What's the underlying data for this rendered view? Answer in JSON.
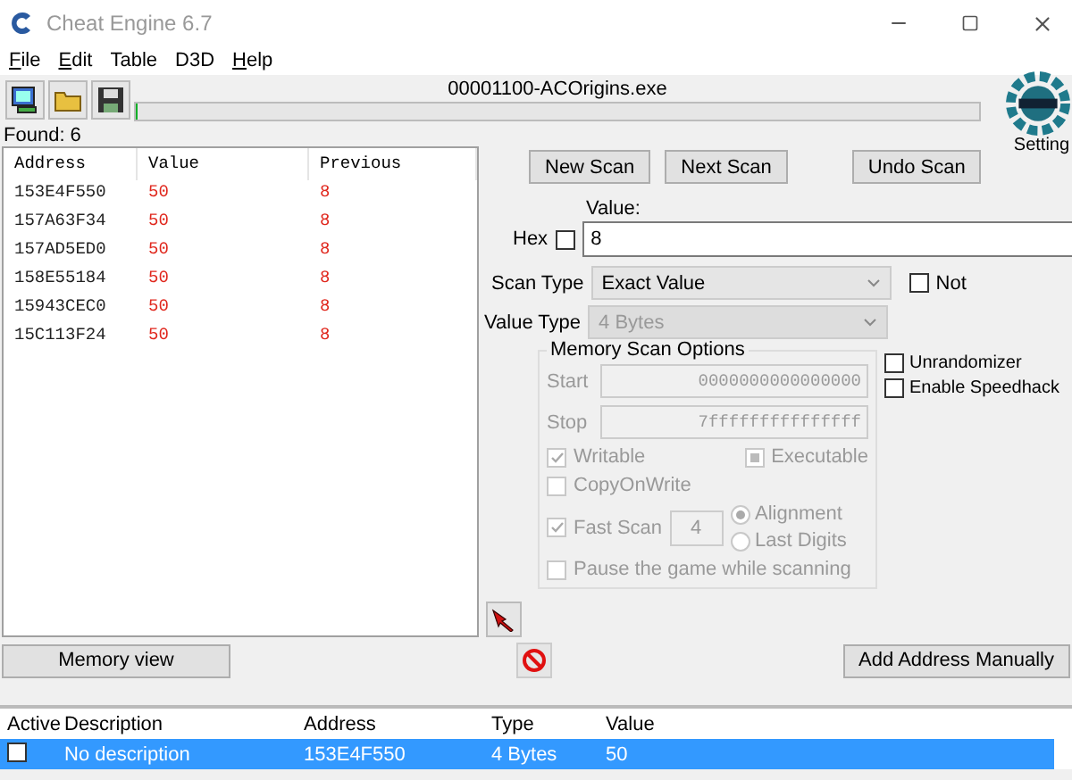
{
  "window": {
    "title": "Cheat Engine 6.7"
  },
  "menu": [
    {
      "label": "File",
      "underlined": true
    },
    {
      "label": "Edit",
      "underlined": true
    },
    {
      "label": "Table",
      "underlined": false
    },
    {
      "label": "D3D",
      "underlined": false
    },
    {
      "label": "Help",
      "underlined": true
    }
  ],
  "process": "00001100-ACOrigins.exe",
  "scan_progress": {
    "level": 0
  },
  "settings_label": "Setting",
  "found": "Found: 6",
  "results": {
    "columns": [
      "Address",
      "Value",
      "Previous"
    ],
    "rows": [
      [
        "153E4F550",
        "50",
        "8"
      ],
      [
        "157A63F34",
        "50",
        "8"
      ],
      [
        "157AD5ED0",
        "50",
        "8"
      ],
      [
        "158E55184",
        "50",
        "8"
      ],
      [
        "15943CEC0",
        "50",
        "8"
      ],
      [
        "15C113F24",
        "50",
        "8"
      ]
    ]
  },
  "scan_buttons": [
    "New Scan",
    "Next Scan",
    "Undo Scan"
  ],
  "value": {
    "label": "Value:",
    "hex_label": "Hex",
    "hex_checked": false,
    "text": "8"
  },
  "scan_type": {
    "label": "Scan Type",
    "value": "Exact Value",
    "disabled": false
  },
  "not_option": {
    "label": "Not",
    "checked": false
  },
  "value_type": {
    "label": "Value Type",
    "value": "4 Bytes",
    "disabled": true
  },
  "memory_options": {
    "title": "Memory Scan Options",
    "disabled": true,
    "start_label": "Start",
    "start": "0000000000000000",
    "stop_label": "Stop",
    "stop": "7fffffffffffffff",
    "writable": {
      "label": "Writable",
      "checked": true
    },
    "executable": {
      "label": "Executable",
      "partial": true
    },
    "copy_on_write": {
      "label": "CopyOnWrite",
      "checked": false
    },
    "fast_scan": {
      "label": "Fast Scan",
      "checked": true,
      "digits": "4"
    },
    "radios": [
      {
        "label": "Alignment",
        "selected": true
      },
      {
        "label": "Last Digits",
        "selected": false
      }
    ],
    "pause": {
      "label": "Pause the game while scanning",
      "checked": false
    }
  },
  "side_options": [
    {
      "label": "Unrandomizer",
      "checked": false
    },
    {
      "label": "Enable Speedhack",
      "checked": false
    }
  ],
  "memory_view_button": "Memory view",
  "add_address_button": "Add Address Manually",
  "address_table": {
    "columns": [
      "Active",
      "Description",
      "Address",
      "Type",
      "Value"
    ],
    "rows": [
      {
        "active": false,
        "description": "No description",
        "address": "153E4F550",
        "type": "4 Bytes",
        "value": "50",
        "selected": true
      }
    ]
  }
}
